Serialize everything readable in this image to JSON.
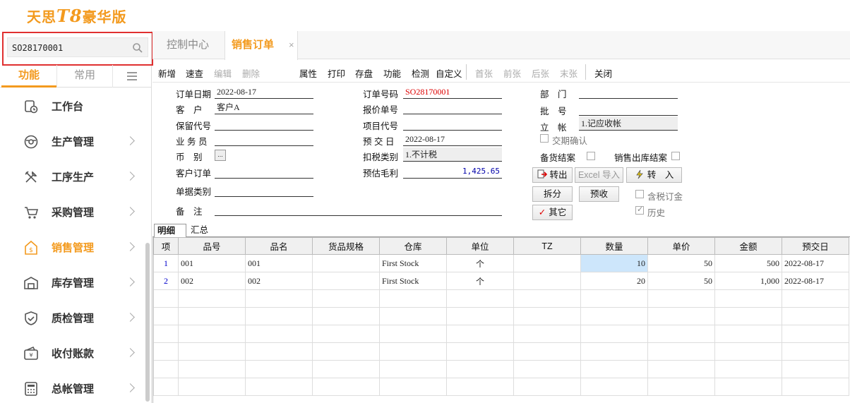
{
  "app": {
    "logo_text": "天思",
    "logo_num": "T8",
    "logo_suffix": "豪华版"
  },
  "search": {
    "value": "SO28170001"
  },
  "side_tabs": {
    "func": "功能",
    "common": "常用"
  },
  "menu": [
    {
      "label": "工作台",
      "icon": "workbench-icon"
    },
    {
      "label": "生产管理",
      "icon": "production-icon"
    },
    {
      "label": "工序生产",
      "icon": "tools-icon"
    },
    {
      "label": "采购管理",
      "icon": "cart-icon"
    },
    {
      "label": "销售管理",
      "icon": "sales-icon",
      "active": true
    },
    {
      "label": "库存管理",
      "icon": "warehouse-icon"
    },
    {
      "label": "质检管理",
      "icon": "shield-check-icon"
    },
    {
      "label": "收付账款",
      "icon": "wallet-icon"
    },
    {
      "label": "总帐管理",
      "icon": "calculator-icon"
    }
  ],
  "page_tabs": {
    "control": "控制中心",
    "sales": "销售订单",
    "close": "×"
  },
  "toolbar": {
    "new": "新增",
    "query": "速查",
    "edit": "编辑",
    "delete": "删除",
    "props": "属性",
    "print": "打印",
    "save": "存盘",
    "func": "功能",
    "check": "检测",
    "custom": "自定义",
    "first": "首张",
    "prev": "前张",
    "next": "后张",
    "last": "末张",
    "close": "关闭"
  },
  "form": {
    "order_date_label": "订单日期",
    "order_date": "2022-08-17",
    "customer_label": "客　户",
    "customer": "客户A",
    "reserve_label": "保留代号",
    "reserve": "",
    "salesman_label": "业 务 员",
    "salesman": "",
    "currency_label": "币　别",
    "currency_btn": "...",
    "cust_order_label": "客户订单",
    "cust_order": "",
    "doc_type_label": "单据类别",
    "doc_type": "",
    "remark_label": "备　注",
    "remark": "",
    "order_no_label": "订单号码",
    "order_no": "SO28170001",
    "quote_no_label": "报价单号",
    "quote_no": "",
    "project_label": "项目代号",
    "project": "",
    "delivery_label": "预 交 日",
    "delivery": "2022-08-17",
    "tax_label": "扣税类别",
    "tax": "1.不计税",
    "profit_label": "预估毛利",
    "profit": "1,425.65",
    "dept_label": "部　门",
    "dept": "",
    "batch_label": "批　号",
    "batch": "",
    "account_label": "立　帐",
    "account": "1.记应收帐",
    "trade_confirm": "交期确认",
    "stock_close": "备货结案",
    "out_close": "销售出库结案",
    "tax_order": "含税订金",
    "history": "历史"
  },
  "buttons": {
    "transfer_out": "转出",
    "excel_import": "Excel 导入",
    "transfer_in": "转　入",
    "split": "拆分",
    "prepay": "预收",
    "other": "其它"
  },
  "grid_tabs": {
    "detail": "明细",
    "summary": "汇总"
  },
  "grid": {
    "headers": [
      "项",
      "品号",
      "品名",
      "货品规格",
      "仓库",
      "单位",
      "TZ",
      "数量",
      "单价",
      "金额",
      "预交日"
    ],
    "rows": [
      [
        "1",
        "001",
        "001",
        "",
        "First Stock",
        "个",
        "",
        "10",
        "50",
        "500",
        "2022-08-17"
      ],
      [
        "2",
        "002",
        "002",
        "",
        "First Stock",
        "个",
        "",
        "20",
        "50",
        "1,000",
        "2022-08-17"
      ]
    ]
  },
  "colors": {
    "accent": "#f39a1e",
    "highlight_box": "#e03030",
    "selected_cell": "#cde6fb"
  }
}
